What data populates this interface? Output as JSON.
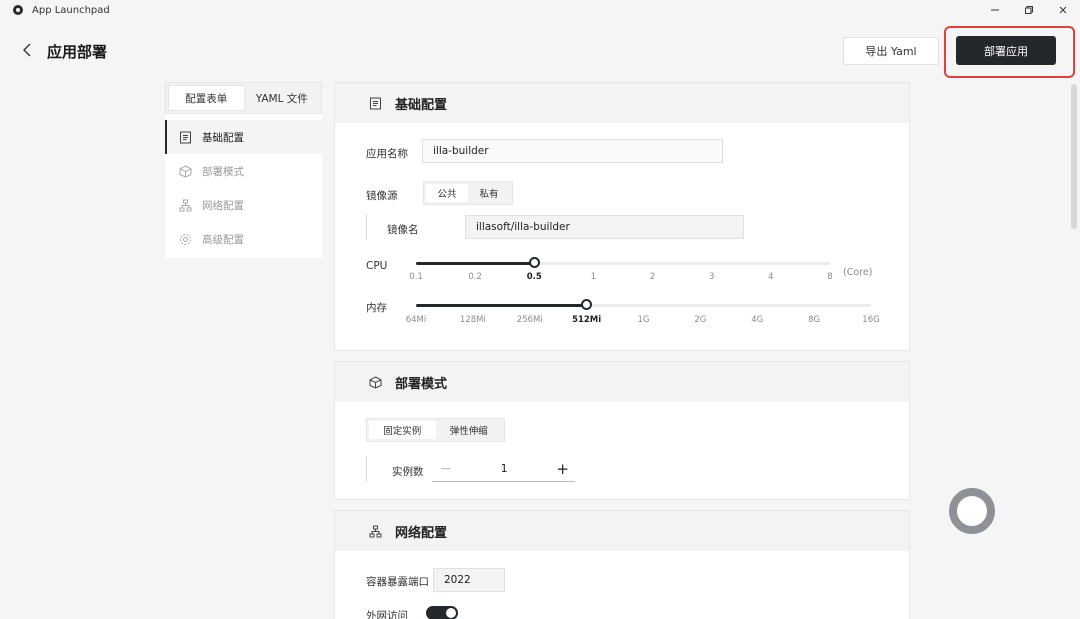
{
  "window": {
    "title": "App Launchpad"
  },
  "header": {
    "title": "应用部署",
    "export_label": "导出 Yaml",
    "deploy_label": "部署应用"
  },
  "nav": {
    "tabs": [
      {
        "label": "配置表单"
      },
      {
        "label": "YAML 文件"
      }
    ],
    "items": [
      {
        "label": "基础配置",
        "icon": "document-icon"
      },
      {
        "label": "部署模式",
        "icon": "cube-icon"
      },
      {
        "label": "网络配置",
        "icon": "network-icon"
      },
      {
        "label": "高级配置",
        "icon": "gear-icon"
      }
    ]
  },
  "basic": {
    "title": "基础配置",
    "app_name_label": "应用名称",
    "app_name_value": "illa-builder",
    "image_source_label": "镜像源",
    "image_source_options": [
      "公共",
      "私有"
    ],
    "image_name_label": "镜像名",
    "image_name_value": "illasoft/illa-builder",
    "cpu": {
      "label": "CPU",
      "ticks": [
        "0.1",
        "0.2",
        "0.5",
        "1",
        "2",
        "3",
        "4",
        "8"
      ],
      "selected": "0.5",
      "unit": "(Core)"
    },
    "memory": {
      "label": "内存",
      "ticks": [
        "64Mi",
        "128Mi",
        "256Mi",
        "512Mi",
        "1G",
        "2G",
        "4G",
        "8G",
        "16G"
      ],
      "selected": "512Mi"
    }
  },
  "deploy_mode": {
    "title": "部署模式",
    "options": [
      "固定实例",
      "弹性伸缩"
    ],
    "instances_label": "实例数",
    "instances_value": "1"
  },
  "network": {
    "title": "网络配置",
    "port_label": "容器暴露端口",
    "port_value": "2022",
    "public_access_label": "外网访问"
  }
}
